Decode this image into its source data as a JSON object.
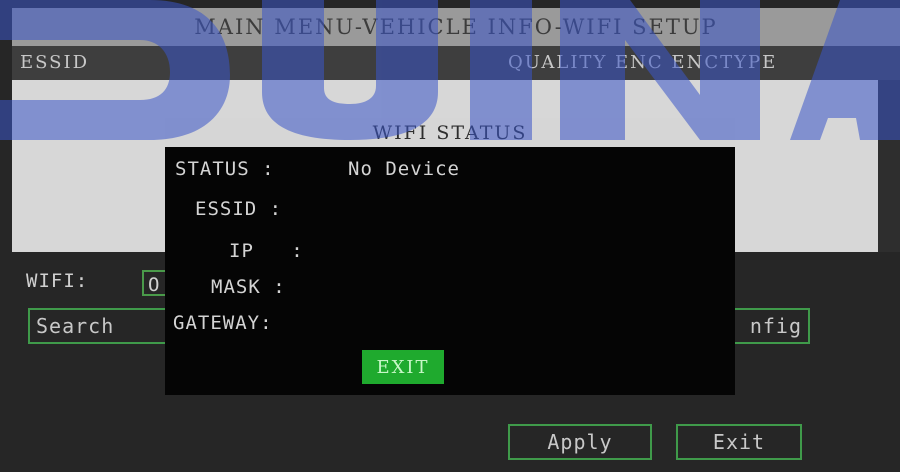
{
  "window": {
    "title": "MAIN MENU-VEHICLE INFO-WIFI SETUP"
  },
  "list": {
    "columns": {
      "essid": "ESSID",
      "quality": "QUALITY ENC ENCTYPE"
    }
  },
  "wifi": {
    "label": "WIFI:",
    "value": "O"
  },
  "buttons": {
    "search": "Search",
    "config": "nfig",
    "apply": "Apply",
    "exit": "Exit"
  },
  "dialog": {
    "title": "WIFI STATUS",
    "rows": [
      {
        "label": "STATUS :",
        "value": "No Device"
      },
      {
        "label": "ESSID :",
        "value": ""
      },
      {
        "label": "IP :",
        "value": ""
      },
      {
        "label": "MASK :",
        "value": ""
      },
      {
        "label": "GATEWAY:",
        "value": ""
      }
    ],
    "exit_label": "EXIT"
  },
  "colors": {
    "accent_green": "#1faa2e",
    "border_green": "#3f9a4a",
    "watermark": "#3a55c8"
  }
}
